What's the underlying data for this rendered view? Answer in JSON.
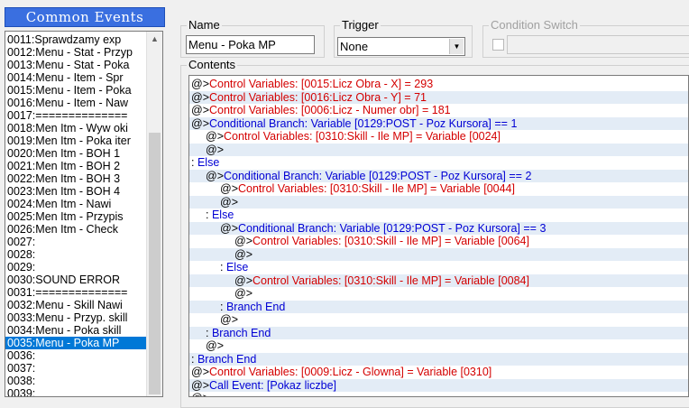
{
  "left_panel": {
    "title": "Common Events",
    "items": [
      "0011:Sprawdzamy exp",
      "0012:Menu - Stat - Przyp",
      "0013:Menu - Stat - Poka",
      "0014:Menu - Item - Spr",
      "0015:Menu - Item - Poka",
      "0016:Menu - Item - Naw",
      "0017:==============",
      "0018:Men Itm - Wyw oki",
      "0019:Men Itm - Poka iter",
      "0020:Men Itm - BOH 1",
      "0021:Men Itm - BOH 2",
      "0022:Men Itm - BOH 3",
      "0023:Men Itm - BOH 4",
      "0024:Men Itm - Nawi",
      "0025:Men Itm - Przypis",
      "0026:Men Itm - Check",
      "0027:",
      "0028:",
      "0029:",
      "0030:SOUND ERROR",
      "0031:==============",
      "0032:Menu - Skill Nawi",
      "0033:Menu - Przyp. skill",
      "0034:Menu - Poka skill",
      "0035:Menu - Poka MP",
      "0036:",
      "0037:",
      "0038:",
      "0039:"
    ],
    "selected_index": 24
  },
  "name_group": {
    "label": "Name",
    "value": "Menu - Poka MP"
  },
  "trigger_group": {
    "label": "Trigger",
    "value": "None"
  },
  "condition_group": {
    "label": "Condition Switch"
  },
  "contents_group": {
    "label": "Contents",
    "lines": [
      {
        "indent": 0,
        "prefix": "@>",
        "text": "Control Variables: [0015:Licz Obra - X] = 293",
        "kind": "control"
      },
      {
        "indent": 0,
        "prefix": "@>",
        "text": "Control Variables: [0016:Licz Obra - Y] = 71",
        "kind": "control"
      },
      {
        "indent": 0,
        "prefix": "@>",
        "text": "Control Variables: [0006:Licz - Numer obr] = 181",
        "kind": "control"
      },
      {
        "indent": 0,
        "prefix": "@>",
        "text": "Conditional Branch: Variable [0129:POST - Poz Kursora] == 1",
        "kind": "cond"
      },
      {
        "indent": 1,
        "prefix": "@>",
        "text": "Control Variables: [0310:Skill - Ile MP] = Variable [0024]",
        "kind": "control"
      },
      {
        "indent": 1,
        "prefix": "@>",
        "text": "",
        "kind": "plain"
      },
      {
        "indent": 0,
        "prefix": " : ",
        "text": "Else",
        "kind": "blue"
      },
      {
        "indent": 1,
        "prefix": "@>",
        "text": "Conditional Branch: Variable [0129:POST - Poz Kursora] == 2",
        "kind": "cond"
      },
      {
        "indent": 2,
        "prefix": "@>",
        "text": "Control Variables: [0310:Skill - Ile MP] = Variable [0044]",
        "kind": "control"
      },
      {
        "indent": 2,
        "prefix": "@>",
        "text": "",
        "kind": "plain"
      },
      {
        "indent": 1,
        "prefix": " : ",
        "text": "Else",
        "kind": "blue"
      },
      {
        "indent": 2,
        "prefix": "@>",
        "text": "Conditional Branch: Variable [0129:POST - Poz Kursora] == 3",
        "kind": "cond"
      },
      {
        "indent": 3,
        "prefix": "@>",
        "text": "Control Variables: [0310:Skill - Ile MP] = Variable [0064]",
        "kind": "control"
      },
      {
        "indent": 3,
        "prefix": "@>",
        "text": "",
        "kind": "plain"
      },
      {
        "indent": 2,
        "prefix": " : ",
        "text": "Else",
        "kind": "blue"
      },
      {
        "indent": 3,
        "prefix": "@>",
        "text": "Control Variables: [0310:Skill - Ile MP] = Variable [0084]",
        "kind": "control"
      },
      {
        "indent": 3,
        "prefix": "@>",
        "text": "",
        "kind": "plain"
      },
      {
        "indent": 2,
        "prefix": " : ",
        "text": "Branch End",
        "kind": "blue"
      },
      {
        "indent": 2,
        "prefix": "@>",
        "text": "",
        "kind": "plain"
      },
      {
        "indent": 1,
        "prefix": " : ",
        "text": "Branch End",
        "kind": "blue"
      },
      {
        "indent": 1,
        "prefix": "@>",
        "text": "",
        "kind": "plain"
      },
      {
        "indent": 0,
        "prefix": " : ",
        "text": "Branch End",
        "kind": "blue"
      },
      {
        "indent": 0,
        "prefix": "@>",
        "text": "Control Variables: [0009:Licz - Glowna] = Variable [0310]",
        "kind": "control"
      },
      {
        "indent": 0,
        "prefix": "@>",
        "text": "Call Event: [Pokaz liczbe]",
        "kind": "cond"
      },
      {
        "indent": 0,
        "prefix": "@>",
        "text": "",
        "kind": "plain"
      }
    ]
  },
  "colors": {
    "title_bar": "#3a6fe0",
    "selection": "#0078d7",
    "command_red": "#d40000",
    "command_blue": "#0000d4",
    "alt_row": "#e3ecf6"
  }
}
